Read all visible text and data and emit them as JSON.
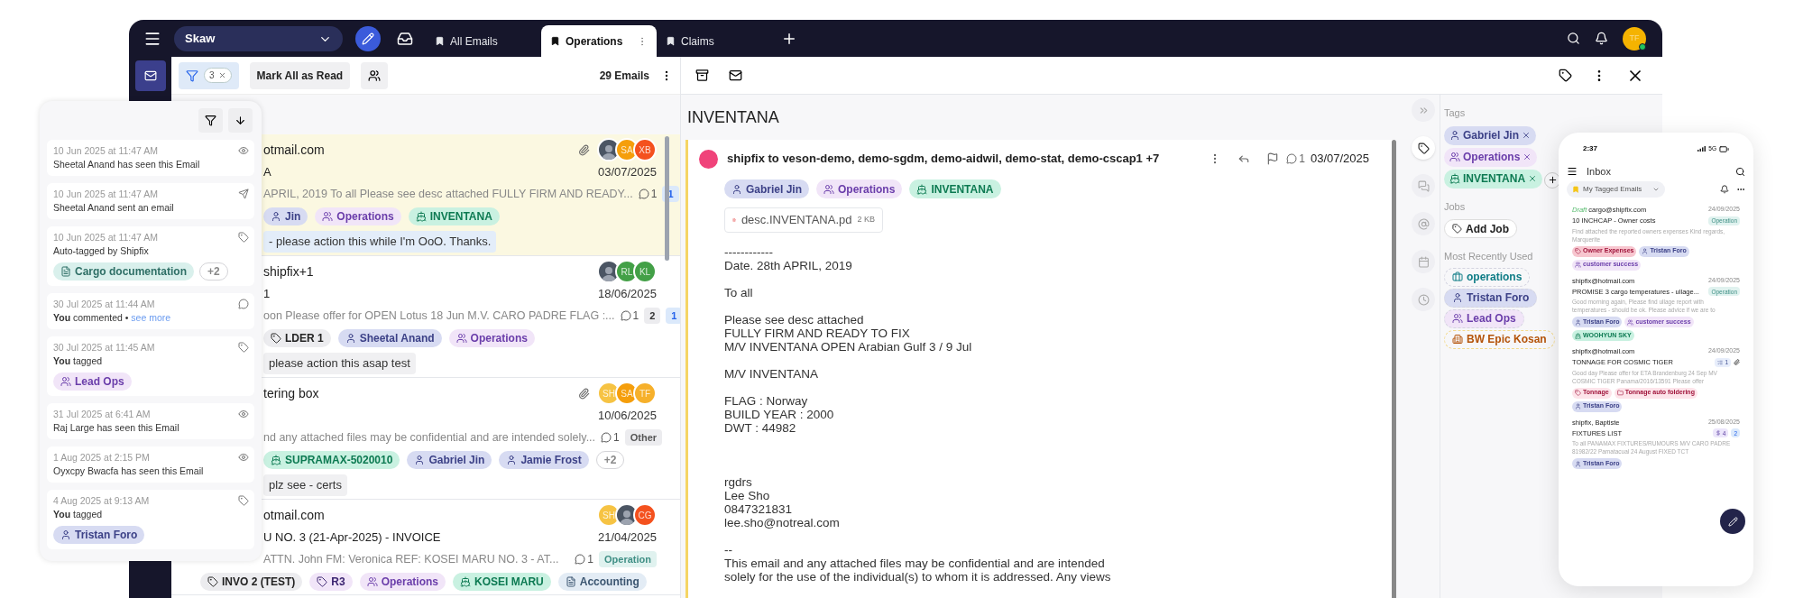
{
  "top_bar": {
    "workspace": "Skaw",
    "tabs": [
      {
        "label": "All Emails",
        "selected": false
      },
      {
        "label": "Operations",
        "selected": true
      },
      {
        "label": "Claims",
        "selected": false
      }
    ],
    "user_initials": "TF"
  },
  "list_toolbar": {
    "filter_count": "3",
    "mark_all_button": "Mark All as Read",
    "email_count": "29 Emails"
  },
  "emails": [
    {
      "highlighted": true,
      "sender": "otmail.com",
      "subject": "A",
      "preview": "APRIL, 2019 To all Please see desc attached FULLY FIRM AND READY...",
      "comments": "1",
      "badges": [
        {
          "label": "1",
          "kind": "unread"
        }
      ],
      "attachment": true,
      "avatars": [
        {
          "kind": "photo"
        },
        {
          "kind": "initials",
          "initials": "SA",
          "color": "#f59e0b"
        },
        {
          "kind": "initials",
          "initials": "XB",
          "color": "#f4511e"
        }
      ],
      "date": "03/07/2025",
      "tags": [
        {
          "label": "Jin",
          "kind": "person"
        },
        {
          "label": "Operations",
          "kind": "group"
        },
        {
          "label": "INVENTANA",
          "kind": "ship"
        }
      ],
      "note": {
        "text": "- please action this while I'm OoO. Thanks.",
        "color": "#e3edf9"
      }
    },
    {
      "highlighted": false,
      "sender": "shipfix+1",
      "subject": "1",
      "preview": "oon Please offer for OPEN Lotus 18 Jun M.V. CARO PADRE FLAG :...",
      "comments": "1",
      "badges": [
        {
          "label": "2",
          "kind": "count"
        },
        {
          "label": "1",
          "kind": "unread"
        }
      ],
      "attachment": false,
      "avatars": [
        {
          "kind": "photo"
        },
        {
          "kind": "initials",
          "initials": "RL",
          "color": "#43a047"
        },
        {
          "kind": "initials",
          "initials": "KL",
          "color": "#43a047"
        }
      ],
      "date": "18/06/2025",
      "tags": [
        {
          "label": "LDER 1",
          "kind": "label"
        },
        {
          "label": "Sheetal Anand",
          "kind": "person"
        },
        {
          "label": "Operations",
          "kind": "group"
        }
      ],
      "note": {
        "text": "please action this asap test",
        "color": "#f0f0f2"
      }
    },
    {
      "highlighted": false,
      "sender": "tering box",
      "preview": "nd any attached files may be confidential and are intended solely...",
      "comments": "1",
      "badges": [
        {
          "label": "Other",
          "kind": "category"
        }
      ],
      "attachment": true,
      "avatars": [
        {
          "kind": "initials",
          "initials": "SH",
          "color": "#f6c343"
        },
        {
          "kind": "initials",
          "initials": "SA",
          "color": "#f59e0b"
        },
        {
          "kind": "initials",
          "initials": "TF",
          "color": "#f6b02b"
        }
      ],
      "date": "10/06/2025",
      "tags": [
        {
          "label": "SUPRAMAX-5020010",
          "kind": "ship"
        },
        {
          "label": "Gabriel Jin",
          "kind": "person"
        },
        {
          "label": "Jamie Frost",
          "kind": "person"
        },
        {
          "label": "+2",
          "kind": "more"
        }
      ],
      "note": {
        "text": "plz see - certs",
        "color": "#f0f0f2"
      }
    },
    {
      "highlighted": false,
      "sender": "otmail.com",
      "subject": "U NO. 3 (21-Apr-2025) - INVOICE",
      "preview": "ATTN. John FM: Veronica REF: KOSEI MARU NO. 3 - AT...",
      "comments": "1",
      "badges": [
        {
          "label": "Operation",
          "kind": "team"
        }
      ],
      "attachment": false,
      "avatars": [
        {
          "kind": "initials",
          "initials": "SH",
          "color": "#f6c343"
        },
        {
          "kind": "photo"
        },
        {
          "kind": "initials",
          "initials": "CG",
          "color": "#f4511e"
        }
      ],
      "date": "21/04/2025",
      "tags": [
        {
          "label": "INVO 2 (TEST)",
          "kind": "label"
        },
        {
          "label": "R3",
          "kind": "label-purple"
        },
        {
          "label": "Operations",
          "kind": "group"
        },
        {
          "label": "KOSEI MARU",
          "kind": "ship"
        },
        {
          "label": "Accounting",
          "kind": "ledger"
        }
      ]
    }
  ],
  "activity": [
    {
      "time": "10 Jun 2025 at 11:47 AM",
      "text": "Sheetal Anand has seen this Email",
      "kind": "eye"
    },
    {
      "time": "10 Jun 2025 at 11:47 AM",
      "text": "Sheetal Anand sent an email",
      "kind": "send"
    },
    {
      "time": "10 Jun 2025 at 11:47 AM",
      "text": "Auto-tagged by Shipfix",
      "kind": "tag",
      "tags": [
        {
          "label": "Cargo documentation",
          "kind": "document"
        },
        {
          "label": "+2",
          "kind": "more"
        }
      ]
    },
    {
      "time": "30 Jul 2025 at 11:44 AM",
      "text": "**You** commented •",
      "link": "see more",
      "kind": "comment"
    },
    {
      "time": "30 Jul 2025 at 11:45 AM",
      "text": "**You** tagged",
      "kind": "tag",
      "tags": [
        {
          "label": "Lead Ops",
          "kind": "group"
        }
      ]
    },
    {
      "time": "31 Jul 2025 at 6:41 AM",
      "text": "Raj Large has seen this Email",
      "kind": "eye"
    },
    {
      "time": "1 Aug 2025 at 2:15 PM",
      "text": "Oyxcpy Bwacfa has seen this Email",
      "kind": "eye"
    },
    {
      "time": "4 Aug 2025 at 9:13 AM",
      "text": "**You** tagged",
      "kind": "tag",
      "tags": [
        {
          "label": "Tristan Foro",
          "kind": "person"
        }
      ]
    }
  ],
  "detail": {
    "subject": "INVENTANA",
    "message": {
      "from": "shipfix to veson-demo, demo-sgdm, demo-aidwil, demo-stat, demo-cscap1 +7",
      "comments": "1",
      "date": "03/07/2025",
      "tags": [
        {
          "label": "Gabriel Jin",
          "kind": "person"
        },
        {
          "label": "Operations",
          "kind": "group"
        },
        {
          "label": "INVENTANA",
          "kind": "ship"
        }
      ],
      "attachment": {
        "name": "desc.INVENTANA.pd",
        "size": "2 KB"
      },
      "body": "------------\nDate. 28th APRIL, 2019\n\nTo all\n\nPlease see desc attached\nFULLY FIRM AND READY TO FIX\nM/V INVENTANA OPEN Arabian Gulf 3 / 9 Jul\n\nM/V INVENTANA\n\nFLAG : Norway\nBUILD YEAR : 2000\nDWT : 44982\n\n\n\nrgdrs\nLee Sho\n0847321831\nlee.sho@notreal.com\n\n--\nThis email and any attached files may be confidential and are intended\nsolely for the use of the individual(s) to whom it is addressed. Any views"
    }
  },
  "side_rail": [
    {
      "kind": "expand",
      "selected": false
    },
    {
      "kind": "tag",
      "selected": true
    },
    {
      "kind": "comment",
      "selected": false
    },
    {
      "kind": "contact",
      "selected": false
    },
    {
      "kind": "calendar",
      "selected": false
    },
    {
      "kind": "history",
      "selected": false
    }
  ],
  "tags_panel": {
    "tags_heading": "Tags",
    "tags": [
      {
        "label": "Gabriel Jin",
        "kind": "person"
      },
      {
        "label": "Operations",
        "kind": "group"
      },
      {
        "label": "INVENTANA",
        "kind": "ship"
      }
    ],
    "jobs_heading": "Jobs",
    "add_job": "Add Job",
    "recent_heading": "Most Recently Used",
    "recent": [
      {
        "label": "operations",
        "kind": "briefcase"
      },
      {
        "label": "Tristan Foro",
        "kind": "person"
      },
      {
        "label": "Lead Ops",
        "kind": "group"
      },
      {
        "label": "BW Epic Kosan",
        "kind": "building"
      }
    ]
  },
  "phone": {
    "time": "2:37",
    "network": "5G",
    "title": "Inbox",
    "filter": "My Tagged Emails",
    "emails": [
      {
        "draft": "Draft",
        "sender": "cargo@shipfix.com",
        "date": "24/09/2025",
        "subject": "10 INCHCAP - Owner costs",
        "badges": [
          {
            "label": "Operation",
            "kind": "team"
          }
        ],
        "attachment": false,
        "preview": "Find attached the reported owners expenses Kind regards, Marquerite",
        "tags": [
          {
            "label": "Owner Expenses",
            "kind": "alert"
          },
          {
            "label": "Tristan Foro",
            "kind": "person"
          },
          {
            "label": "customer success",
            "kind": "group"
          }
        ]
      },
      {
        "sender": "shipfix@hotmail.com",
        "date": "24/09/2025",
        "subject": "PROMISE 3 cargo temperatures - ullage...",
        "badges": [
          {
            "label": "Operation",
            "kind": "team"
          }
        ],
        "attachment": false,
        "preview": "Good morning again, Please find ullage report with temperatures - should be ok. Please advice if we are to",
        "tags": [
          {
            "label": "Tristan Foro",
            "kind": "person"
          },
          {
            "label": "customer success",
            "kind": "group"
          },
          {
            "label": "WOOHYUN SKY",
            "kind": "ship"
          }
        ]
      },
      {
        "sender": "shipfix@hotmail.com",
        "date": "24/09/2025",
        "subject": "TONNAGE FOR COSMIC TIGER",
        "badges": [
          {
            "label": "1",
            "kind": "task"
          }
        ],
        "attachment": true,
        "preview": "Good day Please offer for ETA Brandenburg 24 Sep MV COSMIC TIGER Panama/2016/13591 Please offer",
        "tags": [
          {
            "label": "Tonnage",
            "kind": "pink-label"
          },
          {
            "label": "Tonnage auto foldering",
            "kind": "pink-folder"
          },
          {
            "label": "Tristan Foro",
            "kind": "person"
          }
        ]
      },
      {
        "sender": "shipfix, Baptiste",
        "date": "25/08/2025",
        "subject": "FIXTURES LIST",
        "badges": [
          {
            "label": "4",
            "kind": "money"
          },
          {
            "label": "2",
            "kind": "unread"
          }
        ],
        "attachment": false,
        "preview": "To all PANAMAX FIXTURES/RUMOURS M/V CARO PADRE 81982/22 Pamatacual 24 August FIXED TCT",
        "tags": [
          {
            "label": "Tristan Foro",
            "kind": "person"
          }
        ]
      }
    ]
  }
}
